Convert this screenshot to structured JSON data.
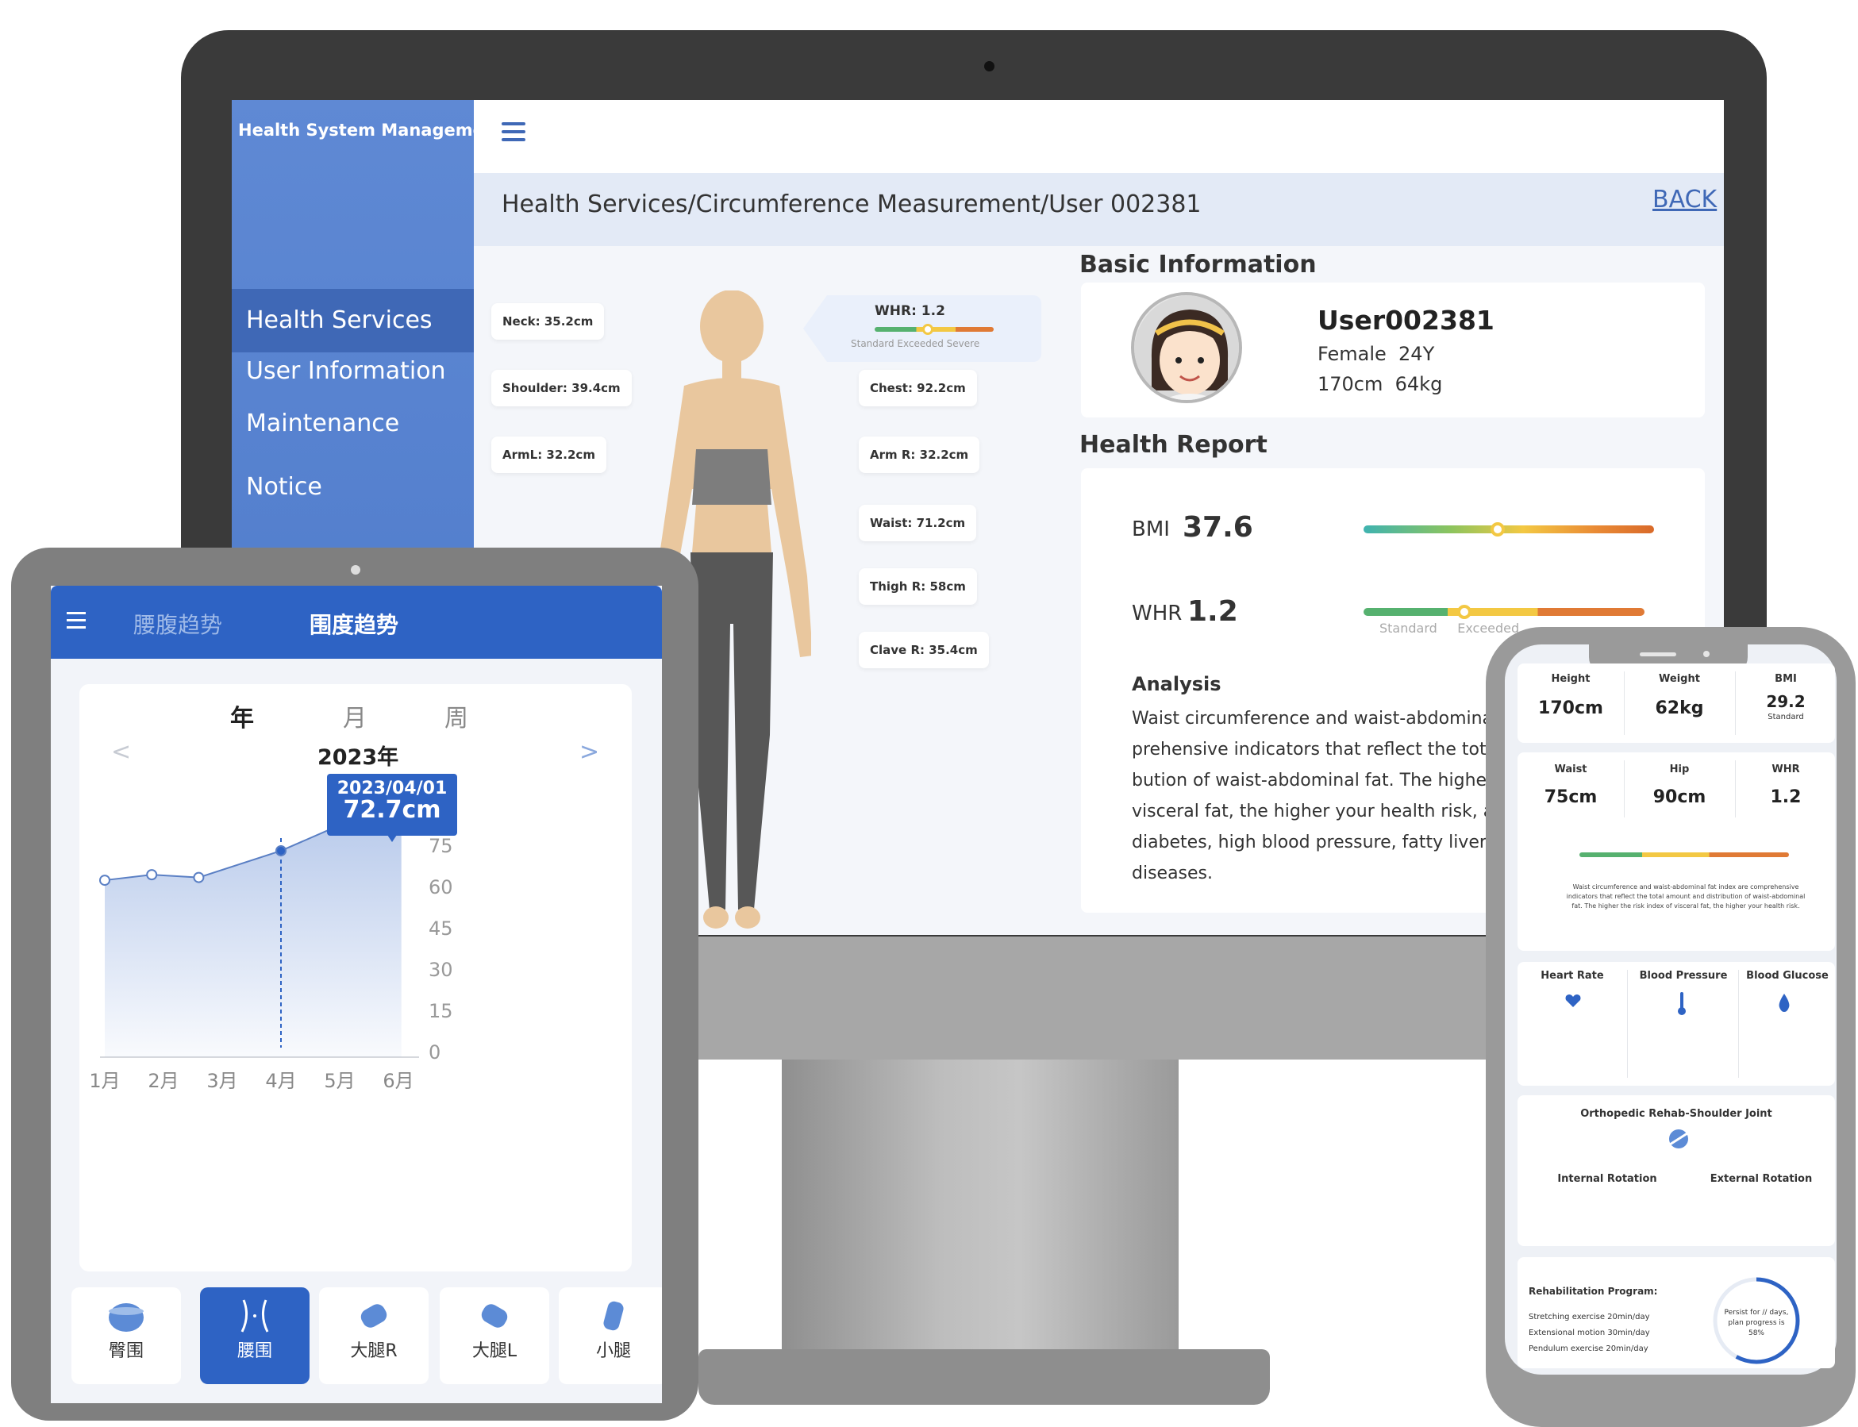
{
  "monitor": {
    "sidebar": {
      "title": "Health System Management",
      "items": [
        {
          "label": "Health Services"
        },
        {
          "label": "User Information"
        },
        {
          "label": "Maintenance Notice"
        }
      ]
    },
    "breadcrumb": "Health Services/Circumference Measurement/User 002381",
    "back_label": "BACK",
    "measurements": {
      "neck": "Neck: 35.2cm",
      "shoulder": "Shoulder: 39.4cm",
      "arm_l": "ArmL: 32.2cm",
      "chest": "Chest: 92.2cm",
      "arm_r": "Arm R: 32.2cm",
      "waist": "Waist: 71.2cm",
      "thigh_r": "Thigh R: 58cm",
      "calve_r": "Clave R: 35.4cm"
    },
    "whr_tag": {
      "label": "WHR: 1.2",
      "scale_labels": "Standard  Exceeded  Severe"
    },
    "basic_info": {
      "heading": "Basic Information",
      "user_id": "User002381",
      "gender_age": "Female  24Y",
      "height_weight": "170cm  64kg"
    },
    "health_report": {
      "heading": "Health Report",
      "bmi_label": "BMI",
      "bmi_value": "37.6",
      "whr_label": "WHR",
      "whr_value": "1.2",
      "whr_scale_labels": "Standard     Exceeded",
      "analysis_heading": "Analysis",
      "analysis_lines": [
        "Waist circumference and waist-abdomina",
        "prehensive indicators that reflect the tota",
        "bution of waist-abdominal fat. The highe",
        "visceral fat, the higher your health risk, a",
        "diabetes, high blood pressure, fatty liver",
        "diseases."
      ]
    }
  },
  "tablet": {
    "tabs": [
      "腰腹趋势",
      "围度趋势"
    ],
    "periods": [
      "年",
      "月",
      "周"
    ],
    "year_label": "2023年",
    "nav_prev": "<",
    "nav_next": ">",
    "tooltip": {
      "date": "2023/04/01",
      "value": "72.7cm"
    },
    "body_parts": [
      {
        "label": "臀围",
        "icon": "hip-icon"
      },
      {
        "label": "腰围",
        "icon": "waist-icon"
      },
      {
        "label": "大腿R",
        "icon": "thigh-right-icon"
      },
      {
        "label": "大腿L",
        "icon": "thigh-left-icon"
      },
      {
        "label": "小腿",
        "icon": "calf-icon"
      }
    ],
    "chart_data": {
      "type": "area",
      "categories": [
        "1月",
        "2月",
        "3月",
        "4月",
        "5月",
        "6月"
      ],
      "x": [
        1,
        2,
        3,
        4,
        5,
        6
      ],
      "points": [
        [
          1,
          62
        ],
        [
          1.8,
          64
        ],
        [
          2.6,
          63
        ],
        [
          4,
          72.7
        ],
        [
          5,
          82
        ],
        [
          6.05,
          89
        ]
      ],
      "ylim": [
        0,
        90
      ],
      "yticks": [
        0,
        15,
        30,
        45,
        60,
        75,
        90
      ],
      "highlight_x": 4,
      "color": "#2e63c4"
    }
  },
  "phone": {
    "stats_row1": [
      {
        "label": "Height",
        "value": "170cm"
      },
      {
        "label": "Weight",
        "value": "62kg"
      },
      {
        "label": "BMI",
        "value": "29.2",
        "sub": "Standard"
      }
    ],
    "stats_row2": [
      {
        "label": "Waist",
        "value": "75cm"
      },
      {
        "label": "Hip",
        "value": "90cm"
      },
      {
        "label": "WHR",
        "value": "1.2"
      }
    ],
    "whr_note": "Waist circumference and waist-abdominal fat index are comprehensive indicators that reflect the total amount and distribution of waist-abdominal fat. The higher the risk index of visceral fat, the higher your health risk.",
    "vitals": [
      "Heart Rate",
      "Blood Pressure",
      "Blood Glucose"
    ],
    "rehab": {
      "title": "Orthopedic Rehab-Shoulder Joint",
      "internal": "Internal Rotation",
      "external": "External Rotation",
      "program_label": "Rehabilitation Program:",
      "program_lines": [
        "Stretching exercise 20min/day",
        "Extensional motion 30min/day",
        "Pendulum exercise 20min/day"
      ],
      "progress_text": "Persist for // days, plan progress is 58%",
      "progress": 0.58
    }
  },
  "colors": {
    "sidebar": "#4b78c9",
    "accent": "#2e63c4",
    "bezel": "#3a3a3a"
  }
}
